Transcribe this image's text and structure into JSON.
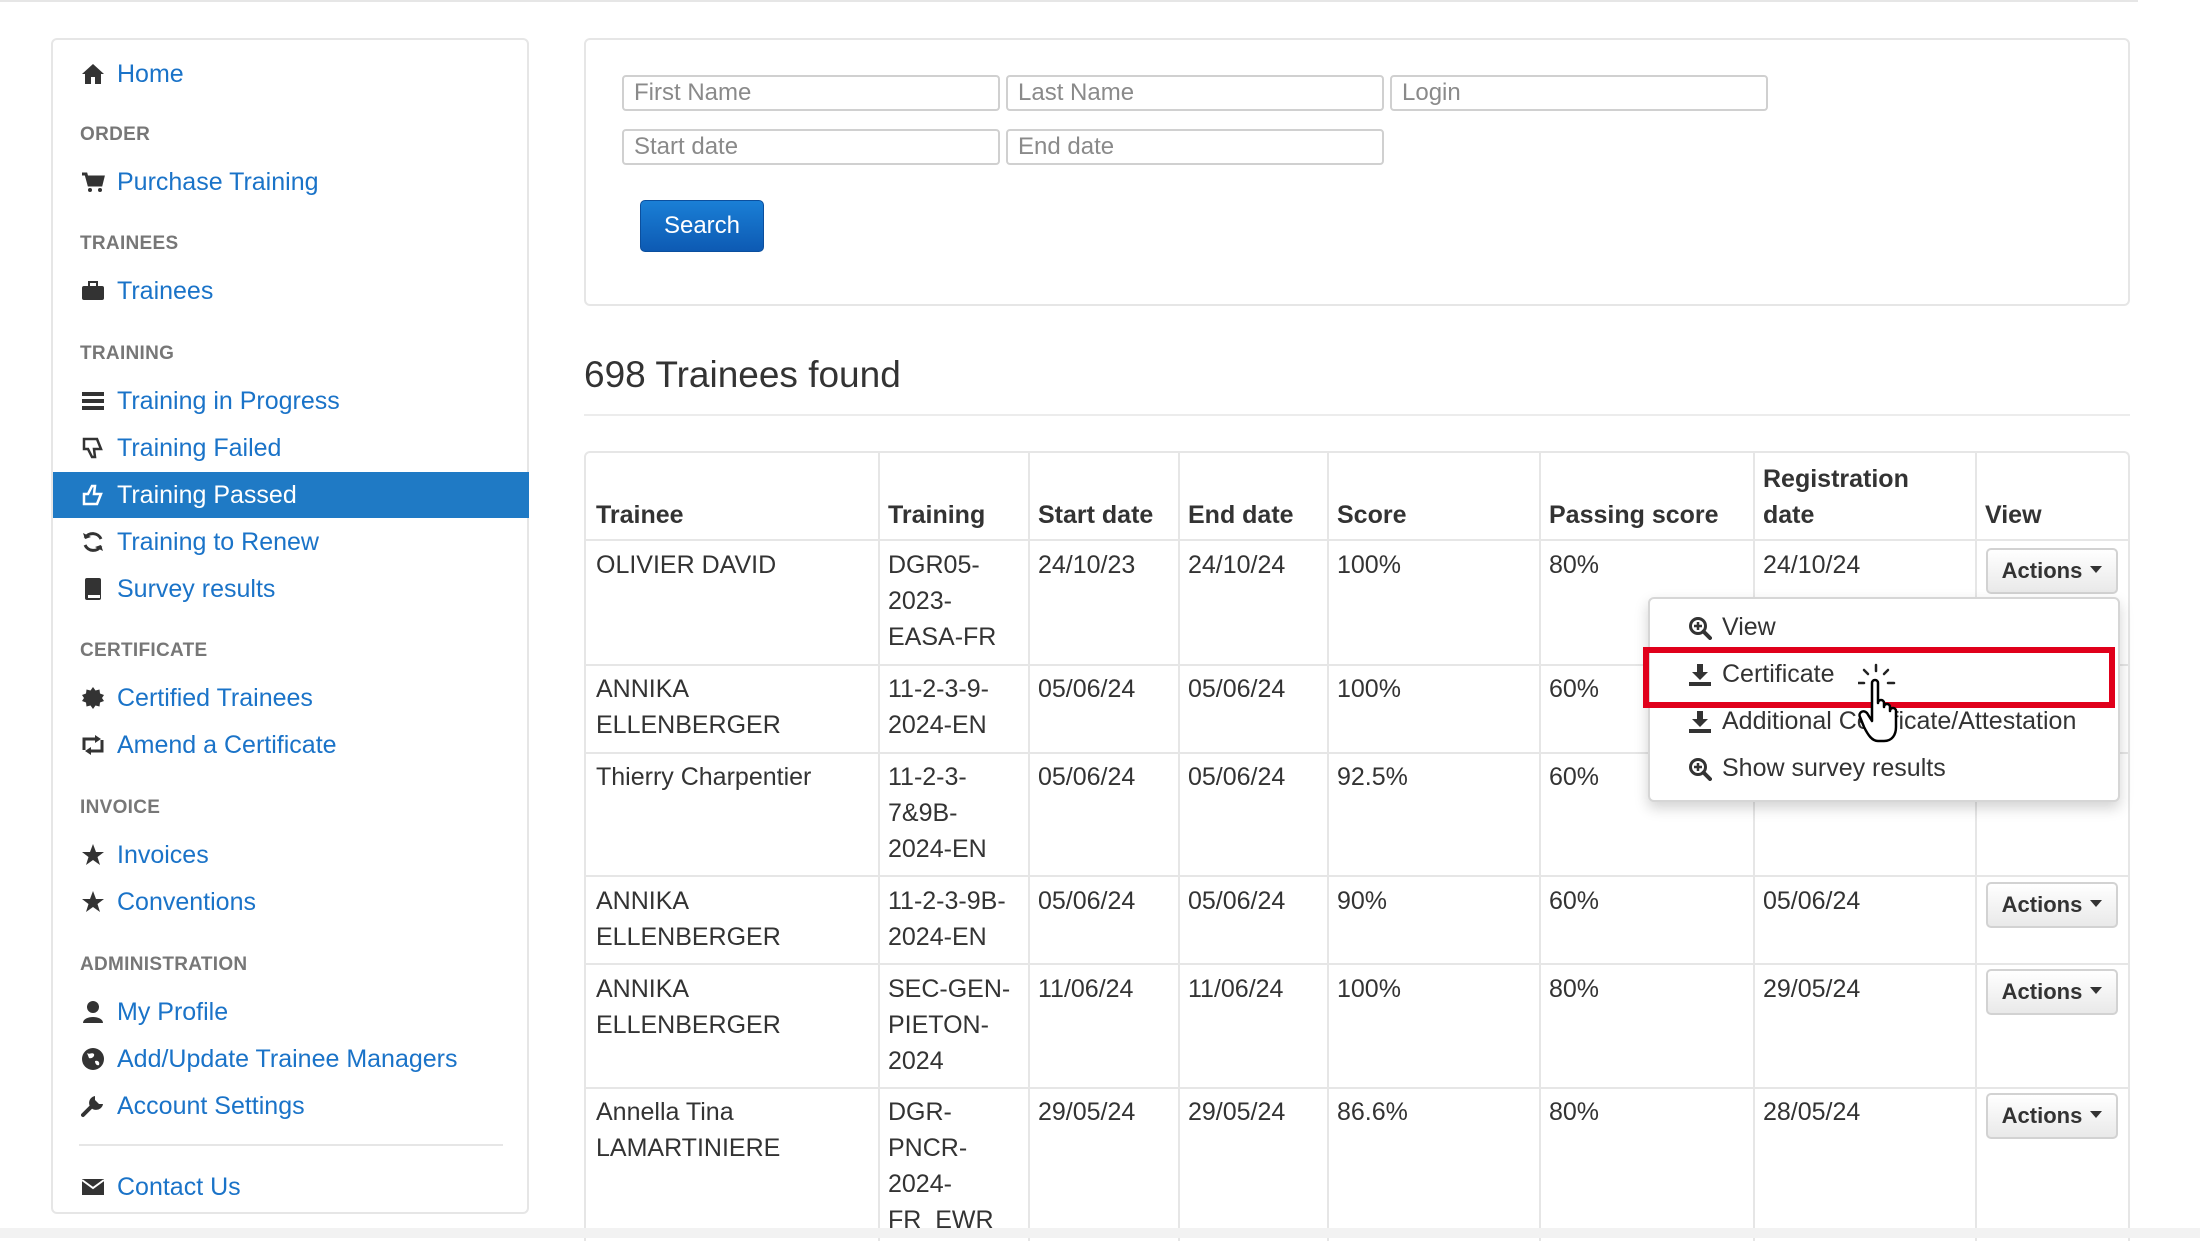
{
  "sidebar": {
    "home": "Home",
    "order_header": "ORDER",
    "purchase_training": "Purchase Training",
    "trainees_header": "TRAINEES",
    "trainees": "Trainees",
    "training_header": "TRAINING",
    "training_in_progress": "Training in Progress",
    "training_failed": "Training Failed",
    "training_passed": "Training Passed",
    "training_to_renew": "Training to Renew",
    "survey_results": "Survey results",
    "certificate_header": "CERTIFICATE",
    "certified_trainees": "Certified Trainees",
    "amend_certificate": "Amend a Certificate",
    "invoice_header": "INVOICE",
    "invoices": "Invoices",
    "conventions": "Conventions",
    "administration_header": "ADMINISTRATION",
    "my_profile": "My Profile",
    "add_update_managers": "Add/Update Trainee Managers",
    "account_settings": "Account Settings",
    "contact_us": "Contact Us"
  },
  "search": {
    "first_name_placeholder": "First Name",
    "last_name_placeholder": "Last Name",
    "login_placeholder": "Login",
    "start_date_placeholder": "Start date",
    "end_date_placeholder": "End date",
    "button": "Search"
  },
  "results_count": "698 Trainees found",
  "table": {
    "headers": {
      "trainee": "Trainee",
      "training": "Training",
      "start_date": "Start date",
      "end_date": "End date",
      "score": "Score",
      "passing_score": "Passing score",
      "registration_date": "Registration\ndate",
      "view": "View"
    },
    "rows": [
      {
        "trainee": "OLIVIER DAVID",
        "training": "DGR05-\n2023-\nEASA-FR",
        "start": "24/10/23",
        "end": "24/10/24",
        "score": "100%",
        "passing": "80%",
        "registration": "24/10/24",
        "action": "Actions"
      },
      {
        "trainee": "ANNIKA\nELLENBERGER",
        "training": "11-2-3-9-\n2024-EN",
        "start": "05/06/24",
        "end": "05/06/24",
        "score": "100%",
        "passing": "60%",
        "registration": "",
        "action": ""
      },
      {
        "trainee": "Thierry Charpentier",
        "training": "11-2-3-\n7&9B-\n2024-EN",
        "start": "05/06/24",
        "end": "05/06/24",
        "score": "92.5%",
        "passing": "60%",
        "registration": "",
        "action": ""
      },
      {
        "trainee": "ANNIKA\nELLENBERGER",
        "training": "11-2-3-9B-\n2024-EN",
        "start": "05/06/24",
        "end": "05/06/24",
        "score": "90%",
        "passing": "60%",
        "registration": "05/06/24",
        "action": "Actions"
      },
      {
        "trainee": "ANNIKA\nELLENBERGER",
        "training": "SEC-GEN-\nPIETON-\n2024",
        "start": "11/06/24",
        "end": "11/06/24",
        "score": "100%",
        "passing": "80%",
        "registration": "29/05/24",
        "action": "Actions"
      },
      {
        "trainee": "Annella Tina\nLAMARTINIERE",
        "training": "DGR-\nPNCR-\n2024-\nFR_EWR",
        "start": "29/05/24",
        "end": "29/05/24",
        "score": "86.6%",
        "passing": "80%",
        "registration": "28/05/24",
        "action": "Actions"
      }
    ]
  },
  "dropdown": {
    "view": "View",
    "certificate": "Certificate",
    "additional": "Additional Certificate/Attestation",
    "survey": "Show survey results"
  },
  "colors": {
    "link": "#1a73c8",
    "active_bg": "#1f7ac5",
    "highlight": "#e0001b",
    "search_button": "#0d5ab3"
  }
}
